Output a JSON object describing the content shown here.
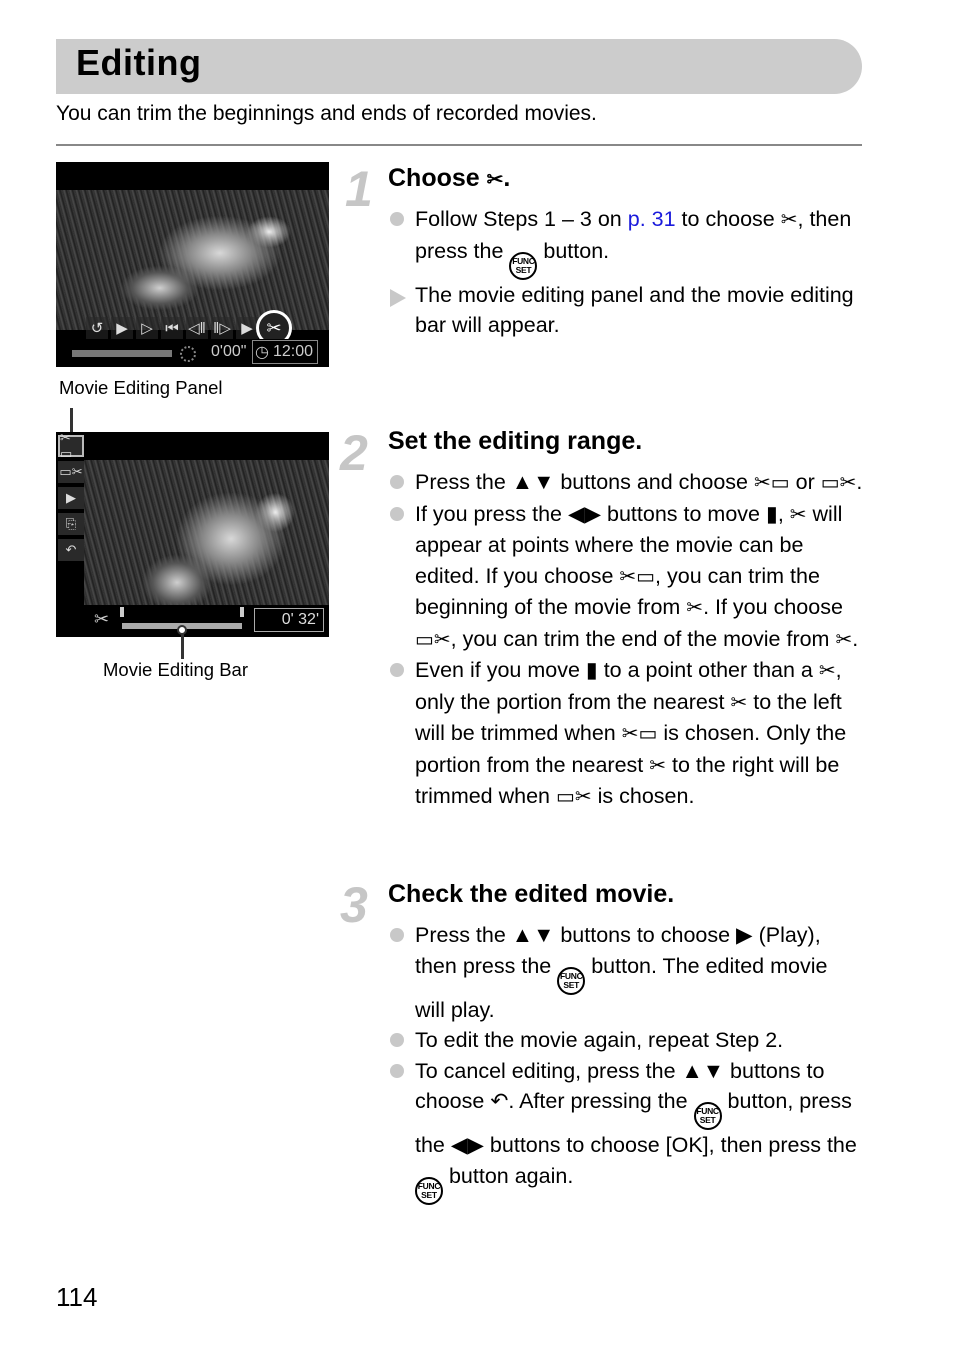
{
  "header": {
    "title": "Editing",
    "intro": "You can trim the beginnings and ends of recorded movies."
  },
  "screens": {
    "panel": {
      "caption": "Movie Editing Panel",
      "controls": [
        "↺",
        "▶",
        "▷",
        "⏮",
        "◁‖",
        "‖▷",
        "▶"
      ],
      "selected_icon": "✂",
      "elapsed": "0'00\"",
      "clock": "12:00"
    },
    "bar": {
      "caption": "Movie Editing Bar",
      "sidebar": [
        "✂▭",
        "▭✂",
        "▶",
        "⎘",
        "↶"
      ],
      "scissor": "✂",
      "length": "0' 32'"
    }
  },
  "steps": [
    {
      "number": "1",
      "heading_text": "Choose",
      "heading_icon": "✂",
      "heading_end": ".",
      "bullets": [
        {
          "type": "dot",
          "parts": [
            "Follow Steps 1 – 3 on ",
            "p. 31",
            " to choose ",
            "✂",
            ", then press the ",
            "FUNC|SET",
            " button."
          ]
        },
        {
          "type": "arrow",
          "parts": [
            "The movie editing panel and the movie editing bar will appear."
          ]
        }
      ]
    },
    {
      "number": "2",
      "heading": "Set the editing range.",
      "bullets": [
        {
          "type": "dot",
          "text_a": "Press the ",
          "updown": "▲▼",
          "text_b": " buttons and choose ",
          "icon_start": "✂▭",
          "text_c": " or ",
          "icon_end": "▭✂",
          "text_d": "."
        },
        {
          "type": "dot",
          "text_a": "If you press the ",
          "leftright": "◀▶",
          "text_b": " buttons to move ",
          "marker": "▮",
          "text_c": ", ",
          "scissor": "✂",
          "text_d": " will appear at points where the movie can be edited. If you choose ",
          "icon_start": "✂▭",
          "text_e": ", you can trim the beginning of the movie from ",
          "scissor2": "✂",
          "text_f": ". If you choose ",
          "icon_end": "▭✂",
          "text_g": ", you can trim the end of the movie from ",
          "scissor3": "✂",
          "text_h": "."
        },
        {
          "type": "dot",
          "text_a": "Even if you move ",
          "marker": "▮",
          "text_b": " to a point other than a ",
          "scissor": "✂",
          "text_c": ", only the portion from the nearest ",
          "scissor2": "✂",
          "text_d": " to the left will be trimmed when ",
          "icon_start": "✂▭",
          "text_e": " is chosen. Only the portion from the nearest ",
          "scissor3": "✂",
          "text_f": " to the right will be trimmed when ",
          "icon_end": "▭✂",
          "text_g": " is chosen."
        }
      ]
    },
    {
      "number": "3",
      "heading": "Check the edited movie.",
      "bullets": [
        {
          "type": "dot",
          "text_a": "Press the ",
          "updown": "▲▼",
          "text_b": " buttons to choose ",
          "play": "▶",
          "text_c": " (Play), then press the ",
          "text_d": " button. The edited movie will play."
        },
        {
          "type": "dot",
          "text_a": "To edit the movie again, repeat Step 2."
        },
        {
          "type": "dot",
          "text_a": "To cancel editing, press the ",
          "updown": "▲▼",
          "text_b": " buttons to choose ",
          "back": "↶",
          "text_c": ". After pressing the ",
          "text_d": " button, press the ",
          "leftright": "◀▶",
          "text_e": " buttons to choose [OK], then press the ",
          "text_f": " button again."
        }
      ]
    }
  ],
  "func_button": {
    "top": "FUNC",
    "bottom": "SET"
  },
  "colors": {
    "link": "#1a1adc",
    "title_bar": "#cccccc",
    "step_number": "#c6c6c6",
    "bullet": "#c8c8c8"
  },
  "page_number": "114"
}
